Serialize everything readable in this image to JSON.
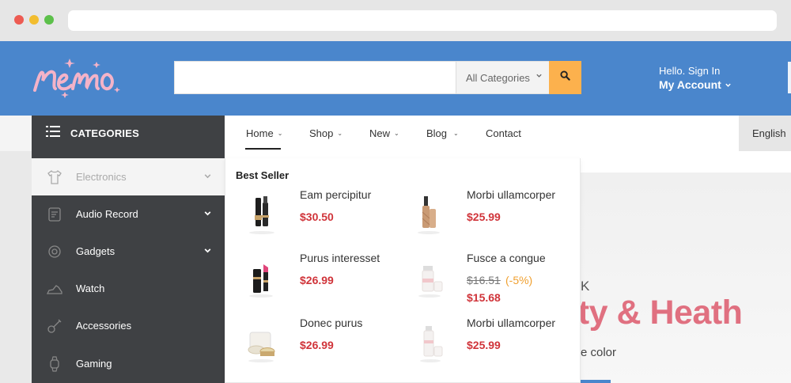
{
  "header": {
    "search_placeholder": "",
    "category_select": "All Categories",
    "account_greeting": "Hello. Sign In",
    "account_label": "My Account",
    "colors": {
      "header_bg": "#4a86cc",
      "search_button": "#fcb14d",
      "sale_price": "#d0343a"
    }
  },
  "nav": {
    "categories_label": "CATEGORIES",
    "items": [
      {
        "label": "Home"
      },
      {
        "label": "Shop"
      },
      {
        "label": "New"
      },
      {
        "label": "Blog"
      },
      {
        "label": "Contact"
      }
    ],
    "language": "English"
  },
  "sidebar": {
    "items": [
      {
        "label": "Electronics",
        "icon": "tshirt-icon"
      },
      {
        "label": "Audio Record",
        "icon": "audio-icon"
      },
      {
        "label": "Gadgets",
        "icon": "gadget-icon"
      },
      {
        "label": "Watch",
        "icon": "shoe-icon"
      },
      {
        "label": "Accessories",
        "icon": "guitar-icon"
      },
      {
        "label": "Gaming",
        "icon": "watch-icon"
      }
    ]
  },
  "dropdown": {
    "title": "Best Seller",
    "products": [
      {
        "name": "Eam percipitur",
        "price": "$30.50"
      },
      {
        "name": "Morbi ullamcorper",
        "price": "$25.99"
      },
      {
        "name": "Purus interesset",
        "price": "$26.99"
      },
      {
        "name": "Fusce a congue",
        "old_price": "$16.51",
        "discount": "(-5%)",
        "price": "$15.68"
      },
      {
        "name": "Donec purus",
        "price": "$26.99"
      },
      {
        "name": "Morbi ullamcorper",
        "price": "$25.99"
      }
    ]
  },
  "hero": {
    "kicker": "K",
    "title": "uty & Heath",
    "subtitle": "e color"
  }
}
